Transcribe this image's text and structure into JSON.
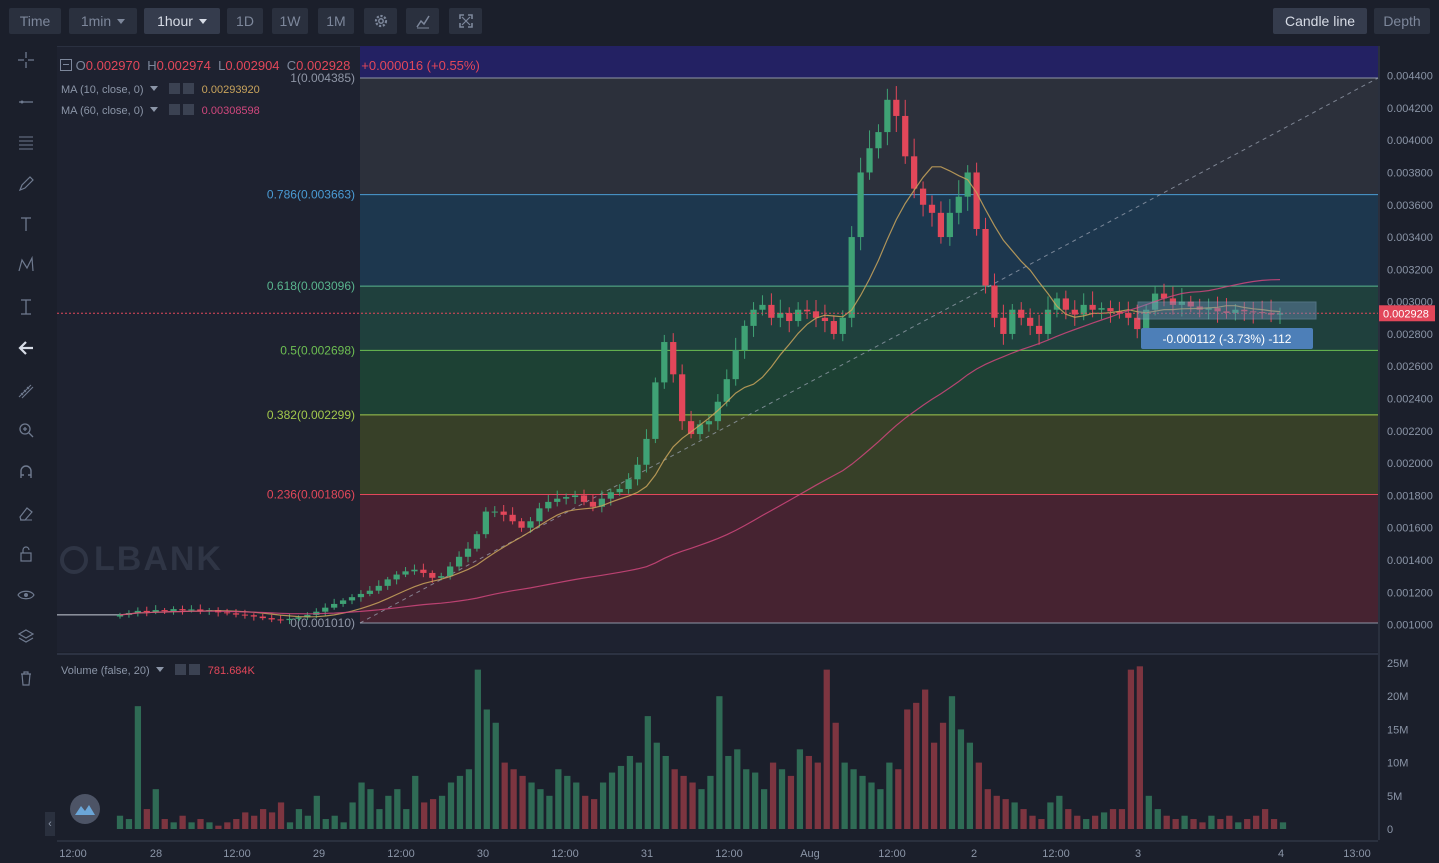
{
  "toolbar": {
    "time": "Time",
    "interval": "1min",
    "resolution": "1hour",
    "d1": "1D",
    "w1": "1W",
    "m1": "1M",
    "candle_line": "Candle line",
    "depth": "Depth"
  },
  "left_tools": [
    "crosshair-icon",
    "horizontal-line-icon",
    "fib-lines-icon",
    "pen-icon",
    "text-icon",
    "pattern-icon",
    "measure-icon",
    "back-arrow-icon",
    "ruler-icon",
    "zoom-icon",
    "magnet-icon",
    "erase-icon",
    "lock-icon",
    "eye-icon",
    "layers-icon",
    "trash-icon"
  ],
  "legend": {
    "o_label": "O",
    "o_value": "0.002970",
    "h_label": "H",
    "h_value": "0.002974",
    "l_label": "L",
    "l_value": "0.002904",
    "c_label": "C",
    "c_value": "0.002928",
    "change": "+0.000016 (+0.55%)",
    "ma10_label": "MA (10, close, 0)",
    "ma10_value": "0.00293920",
    "ma60_label": "MA (60, close, 0)",
    "ma60_value": "0.00308598",
    "volume_label": "Volume (false, 20)",
    "volume_value": "781.684K"
  },
  "colors": {
    "up": "#3fa275",
    "down": "#e2475a",
    "ma10": "#c9a45c",
    "ma60": "#d0477d",
    "accent": "#4d7fb8"
  },
  "watermark": "LBANK",
  "current_price_label": "0.002928",
  "measure_label": "-0.000112 (-3.73%) -112",
  "chart_data": {
    "type": "candlestick",
    "price_axis": [
      "0.004400",
      "0.004200",
      "0.004000",
      "0.003800",
      "0.003600",
      "0.003400",
      "0.003200",
      "0.003000",
      "0.002800",
      "0.002600",
      "0.002400",
      "0.002200",
      "0.002000",
      "0.001800",
      "0.001600",
      "0.001400",
      "0.001200",
      "0.001000"
    ],
    "volume_axis": [
      "25M",
      "20M",
      "15M",
      "10M",
      "5M",
      "0"
    ],
    "time_axis": [
      "12:00",
      "28",
      "12:00",
      "29",
      "12:00",
      "30",
      "12:00",
      "31",
      "12:00",
      "Aug",
      "12:00",
      "2",
      "12:00",
      "3",
      "4",
      "13:00"
    ],
    "ylim": [
      0.00095,
      0.0045
    ],
    "fibonacci": [
      {
        "level": "1",
        "value": 0.004385,
        "label": "1(0.004385)",
        "color": "#8f96a6"
      },
      {
        "level": "0.786",
        "value": 0.003663,
        "label": "0.786(0.003663)",
        "color": "#4a9bd4"
      },
      {
        "level": "0.618",
        "value": 0.003096,
        "label": "0.618(0.003096)",
        "color": "#59b58e"
      },
      {
        "level": "0.5",
        "value": 0.002698,
        "label": "0.5(0.002698)",
        "color": "#6dbf52"
      },
      {
        "level": "0.382",
        "value": 0.002299,
        "label": "0.382(0.002299)",
        "color": "#a3c94c"
      },
      {
        "level": "0.236",
        "value": 0.001806,
        "label": "0.236(0.001806)",
        "color": "#e2475a"
      },
      {
        "level": "0",
        "value": 0.00101,
        "label": "0(0.001010)",
        "color": "#8f96a6"
      }
    ],
    "close": [
      0.00106,
      0.001072,
      0.001085,
      0.001078,
      0.00109,
      0.001083,
      0.001096,
      0.001088,
      0.001094,
      0.001082,
      0.00109,
      0.001076,
      0.00107,
      0.001062,
      0.001058,
      0.00105,
      0.00104,
      0.001032,
      0.001028,
      0.001036,
      0.001045,
      0.00106,
      0.00108,
      0.001105,
      0.001128,
      0.00115,
      0.00117,
      0.00119,
      0.00121,
      0.00124,
      0.00128,
      0.00131,
      0.00133,
      0.00134,
      0.00132,
      0.00129,
      0.0013,
      0.00136,
      0.00142,
      0.00147,
      0.00156,
      0.0017,
      0.0017,
      0.00168,
      0.00164,
      0.0016,
      0.00164,
      0.00172,
      0.00176,
      0.00178,
      0.00179,
      0.0018,
      0.00176,
      0.00173,
      0.00178,
      0.00182,
      0.00184,
      0.0019,
      0.00199,
      0.00215,
      0.0025,
      0.00275,
      0.00255,
      0.00226,
      0.00218,
      0.00224,
      0.00226,
      0.00238,
      0.00252,
      0.0027,
      0.00285,
      0.00295,
      0.00298,
      0.0029,
      0.00293,
      0.00288,
      0.00295,
      0.00294,
      0.0029,
      0.00288,
      0.0028,
      0.0029,
      0.0034,
      0.0038,
      0.00395,
      0.00405,
      0.00425,
      0.00415,
      0.0039,
      0.0037,
      0.0036,
      0.00355,
      0.0034,
      0.00355,
      0.00365,
      0.0038,
      0.00345,
      0.0031,
      0.0029,
      0.0028,
      0.00295,
      0.0029,
      0.00285,
      0.0028,
      0.00295,
      0.00302,
      0.00295,
      0.00292,
      0.00298,
      0.00295,
      0.00296,
      0.00294,
      0.00293,
      0.0029,
      0.00283,
      0.00295,
      0.00305,
      0.00302,
      0.00298,
      0.003,
      0.00297,
      0.00295,
      0.00296,
      0.00294,
      0.00293,
      0.00295,
      0.00294,
      0.002935,
      0.00293,
      0.00292,
      0.002928
    ],
    "volume_m": [
      2,
      1.5,
      18.5,
      3,
      6,
      1.5,
      1,
      2,
      1,
      1.5,
      1,
      0.5,
      1,
      1.5,
      2.5,
      2,
      3,
      2.5,
      4,
      1,
      3,
      2,
      5,
      1.5,
      2,
      1,
      4,
      7,
      6,
      3,
      5,
      6,
      3,
      8,
      4,
      4.5,
      5,
      7,
      8,
      9,
      24,
      18,
      16,
      10,
      9,
      8,
      7,
      6,
      5,
      9,
      8,
      7,
      5,
      4.5,
      7,
      8.5,
      9.5,
      11,
      10,
      17,
      13,
      11,
      9,
      8,
      7,
      6,
      8,
      20,
      11,
      12,
      9,
      8.5,
      6,
      10,
      9,
      8,
      12,
      11,
      10,
      24,
      16,
      10,
      9,
      8,
      7,
      6,
      10,
      9,
      18,
      19,
      21,
      13,
      16,
      20,
      15,
      13,
      10,
      6,
      5,
      4.5,
      4,
      3,
      2,
      1.5,
      4,
      5,
      3,
      2,
      1.5,
      2,
      2.5,
      3,
      3,
      24,
      24.5,
      5,
      3,
      2,
      1.5,
      2,
      1.5,
      1,
      2,
      1.5,
      2,
      1,
      1.5,
      2,
      3,
      1.5,
      1
    ]
  }
}
